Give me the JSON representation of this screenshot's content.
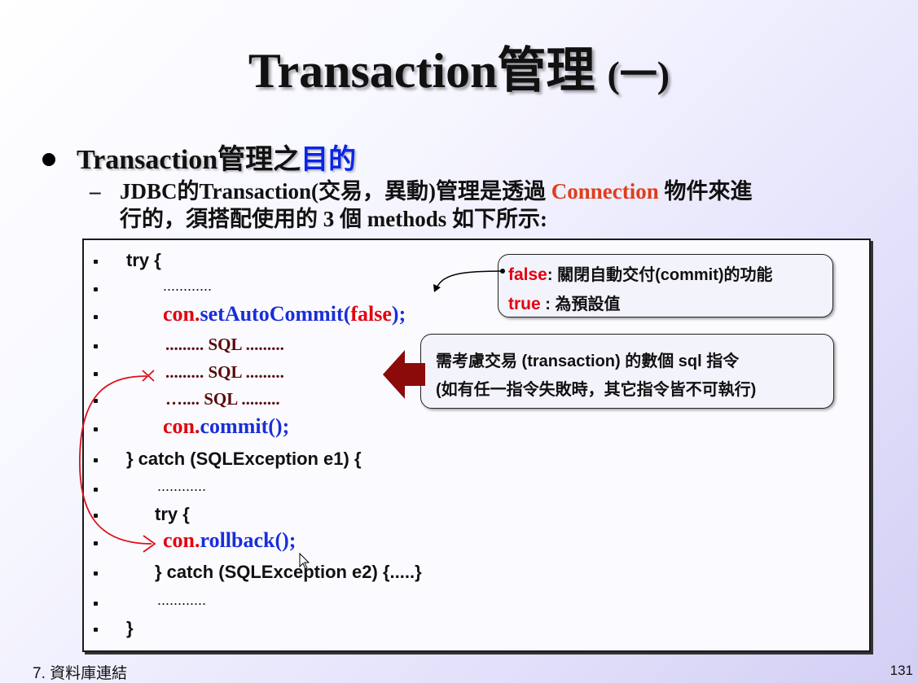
{
  "slide": {
    "title_main": "Transaction管理 ",
    "title_paren": "(一)",
    "bullet1_prefix": "Transaction管理之",
    "bullet1_highlight": "目的",
    "bullet2_dash": "–",
    "bullet2_line1_a": "JDBC的Transaction(交易，異動)管理是透過 ",
    "bullet2_line1_conn": "Connection",
    "bullet2_line1_b": " 物件來進",
    "bullet2_line2": "行的，須搭配使用的 3 個 methods 如下所示:"
  },
  "code": {
    "lines": {
      "try_open": "try {",
      "dots1": "............",
      "set_prefix": "con.",
      "set_method": "setAutoCommit",
      "set_paren_open": "(",
      "set_arg": "false",
      "set_paren_close": ");",
      "sql1": "......... SQL .........",
      "sql2": "......... SQL .........",
      "sql3": "….... SQL .........",
      "commit_prefix": "con.",
      "commit_method": "commit",
      "commit_paren": "();",
      "catch1": "} catch (SQLException e1) {",
      "dots2": "............",
      "try_inner": "try {",
      "rollback_prefix": "con.",
      "rollback_method": "rollback",
      "rollback_paren": "();",
      "catch2": "} catch (SQLException e2) {.....}",
      "dots3": "............",
      "close": "}"
    }
  },
  "callouts": {
    "autocommit": {
      "false_word": "false",
      "false_text": ": 關閉自動交付(commit)的功能",
      "true_word": "true",
      "true_text": " : 為預設值"
    },
    "transaction": {
      "line1": "需考慮交易 (transaction) 的數個 sql 指令",
      "line2": "(如有任一指令失敗時，其它指令皆不可執行)"
    }
  },
  "footer": {
    "chapter": "7. 資料庫連結",
    "page": "131"
  },
  "colors": {
    "red": "#e20010",
    "blue": "#1a2ed8",
    "connection_orange": "#e03d1a",
    "arrow_darkred": "#8b0a0a"
  }
}
